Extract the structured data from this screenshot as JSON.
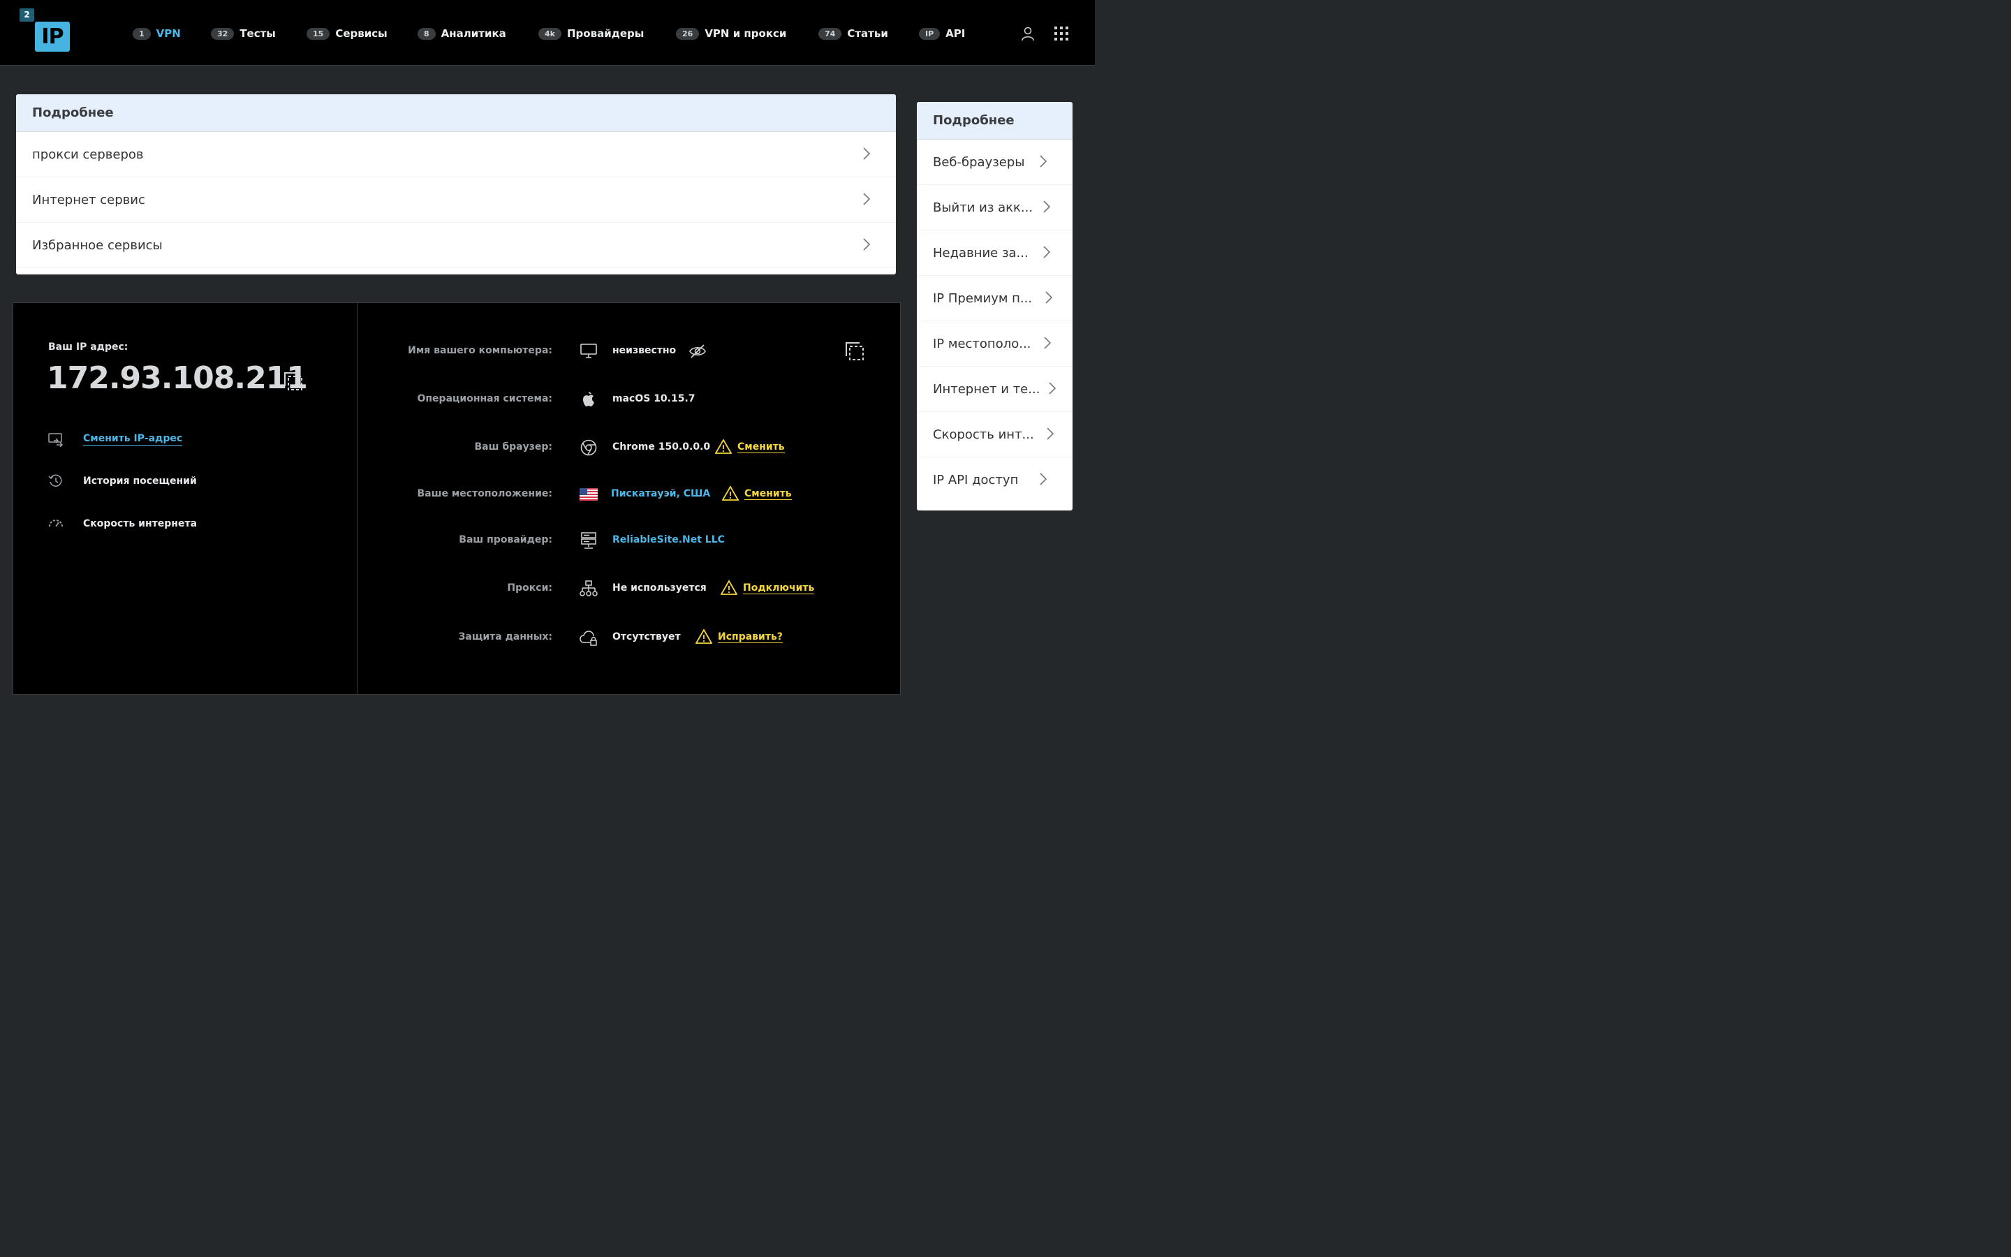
{
  "header": {
    "logo": {
      "small": "2",
      "big": "IP"
    },
    "nav": [
      {
        "badge": "1",
        "label": "VPN"
      },
      {
        "badge": "32",
        "label": "Тесты"
      },
      {
        "badge": "15",
        "label": "Сервисы"
      },
      {
        "badge": "8",
        "label": "Аналитика"
      },
      {
        "badge": "4k",
        "label": "Провайдеры"
      },
      {
        "badge": "26",
        "label": "VPN и прокси"
      },
      {
        "badge": "74",
        "label": "Статьи"
      },
      {
        "badge": "IP",
        "label": "API"
      }
    ]
  },
  "main_card": {
    "title": "Подробнее",
    "items": [
      "прокси серверов",
      "Интернет сервис",
      "Избранное сервисы"
    ]
  },
  "side_card": {
    "title": "Подробнее",
    "items": [
      "Веб-браузеры",
      "Выйти из акк...",
      "Недавние за...",
      "IP Премиум п...",
      "IP местополо...",
      "Интернет и те...",
      "Скорость инт...",
      "IP API доступ"
    ]
  },
  "ip_panel": {
    "label": "Ваш IP адрес:",
    "ip": "172.93.108.211",
    "links": {
      "change_ip": "Сменить IP-адрес",
      "history": "История посещений",
      "speed": "Скорость интернета"
    }
  },
  "info": {
    "computer_name": {
      "label": "Имя вашего компьютера:",
      "value": "неизвестно"
    },
    "os": {
      "label": "Операционная система:",
      "value": "macOS 10.15.7"
    },
    "browser": {
      "label": "Ваш браузер:",
      "value": "Chrome 150.0.0.0",
      "action": "Сменить"
    },
    "location": {
      "label": "Ваше местоположение:",
      "value": "Пискатауэй, США",
      "action": "Сменить"
    },
    "provider": {
      "label": "Ваш провайдер:",
      "value": "ReliableSite.Net LLC"
    },
    "proxy": {
      "label": "Прокси:",
      "value": "Не используется",
      "action": "Подключить"
    },
    "protection": {
      "label": "Защита данных:",
      "value": "Отсутствует",
      "action": "Исправить?"
    }
  },
  "colors": {
    "accent": "#4db6e6",
    "warning": "#f5d63d",
    "background": "#25282b",
    "panel": "#000000",
    "card_header": "#e6effc"
  }
}
